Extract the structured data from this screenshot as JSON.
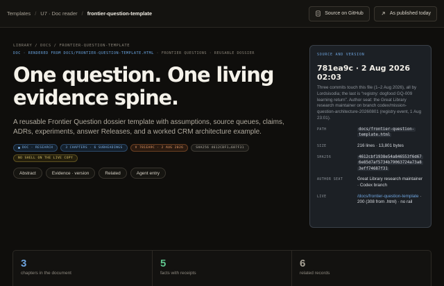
{
  "breadcrumb": {
    "items": [
      "Templates",
      "U7 · Doc reader",
      "frontier-question-template"
    ]
  },
  "toolbar": {
    "github_label": "Source on GitHub",
    "published_label": "As published today"
  },
  "eyebrow": "LIBRARY / DOCS / FRONTIER-QUESTION-TEMPLATE",
  "meta": {
    "doc": "DOC · RENDERED FROM DOCS/FRONTIER-QUESTION-TEMPLATE.HTML",
    "rest": " · FRONTIER QUESTIONS · REUSABLE DOSSIER"
  },
  "title": "One question. One living evidence spine.",
  "subtitle": "A reusable Frontier Question dossier template with assumptions, source queues, claims, ADRs, experiments, answer Releases, and a worked CRM architecture example.",
  "chips": [
    {
      "label": "DOC · RESEARCH",
      "color": "blue"
    },
    {
      "label": "3 CHAPTERS · 6 SUBHEADINGS",
      "color": "blue"
    },
    {
      "label": "V 781EA9C · 2 AUG 2026",
      "color": "orange"
    },
    {
      "label": "SHA256 4612CBF1…687F31",
      "color": "gray"
    },
    {
      "label": "NO SHELL ON THE LIVE COPY",
      "color": "yellow"
    }
  ],
  "tabs": [
    "Abstract",
    "Evidence · version",
    "Related",
    "Agent entry"
  ],
  "source_card": {
    "title": "SOURCE AND VERSION",
    "heading": "781ea9c · 2 Aug 2026 02:03",
    "description": "Three commits touch this file (1–2 Aug 2026), all by Lordsisodia; the last is “registry: dogfood GQ-009 learning return”. Author seat: the Great Library research maintainer on branch codex/mission-question-architecture-20260801 (registry event, 1 Aug 23:01).",
    "path_label": "PATH",
    "path": "docs/frontier-question-template.html",
    "size_label": "SIZE",
    "size": "216 lines · 13,801 bytes",
    "sha_label": "SHA256",
    "sha": "4612cbf1938e54a846553f6d676e85d7af5734b79063724a73a83eff74687f31",
    "seat_label": "AUTHOR SEAT",
    "seat": "Great Library research maintainer · Codex branch",
    "live_label": "LIVE",
    "live_link": "/docs/frontier-question-template",
    "live_rest": " · 200 (308 from .html) · no rail"
  },
  "stats": [
    {
      "value": "3",
      "label": "chapters in the document"
    },
    {
      "value": "5",
      "label": "facts with receipts"
    },
    {
      "value": "6",
      "label": "related records"
    }
  ]
}
